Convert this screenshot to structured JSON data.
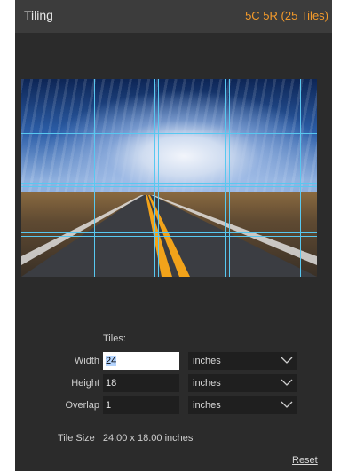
{
  "header": {
    "title": "Tiling",
    "grid_summary": "5C 5R (25 Tiles)"
  },
  "preview": {
    "image": "road-clouds-photo",
    "grid_columns": 5,
    "grid_rows": 5,
    "grid_color": "#58c8f0"
  },
  "form": {
    "tiles_label": "Tiles:",
    "width": {
      "label": "Width",
      "value": "24",
      "unit": "inches"
    },
    "height": {
      "label": "Height",
      "value": "18",
      "unit": "inches"
    },
    "overlap": {
      "label": "Overlap",
      "value": "1",
      "unit": "inches"
    },
    "tile_size_label": "Tile Size",
    "tile_size_value": "24.00 x 18.00 inches"
  },
  "actions": {
    "reset": "Reset"
  },
  "colors": {
    "accent": "#f39a2b",
    "panel": "#2b2b2b",
    "header": "#3c3c3c"
  }
}
